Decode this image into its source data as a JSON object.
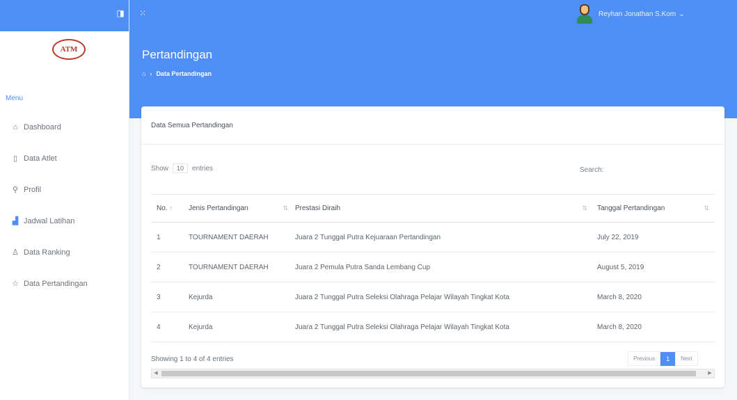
{
  "sidebar": {
    "logo_text": "ATM",
    "menu_title": "Menu",
    "items": [
      {
        "label": "Dashboard",
        "icon": "home-icon"
      },
      {
        "label": "Data Atlet",
        "icon": "document-icon"
      },
      {
        "label": "Profil",
        "icon": "user-icon"
      },
      {
        "label": "Jadwal Latihan",
        "icon": "bar-chart-icon"
      },
      {
        "label": "Data Ranking",
        "icon": "person-icon"
      },
      {
        "label": "Data Pertandingan",
        "icon": "star-icon"
      }
    ]
  },
  "header": {
    "user_name": "Reyhan Jonathan S.Kom"
  },
  "page": {
    "title": "Pertandingan",
    "breadcrumb_current": "Data Pertandingan"
  },
  "card": {
    "title": "Data Semua Pertandingan",
    "show_label": "Show",
    "show_value": "10",
    "entries_label": "entries",
    "search_label": "Search:",
    "columns": [
      "No.",
      "Jenis Pertandingan",
      "Prestasi Diraih",
      "Tanggal Pertandingan"
    ],
    "rows": [
      {
        "no": "1",
        "jenis": "TOURNAMENT DAERAH",
        "prestasi": "Juara 2 Tunggal Putra Kejuaraan Pertandingan",
        "tanggal": "July 22, 2019"
      },
      {
        "no": "2",
        "jenis": "TOURNAMENT DAERAH",
        "prestasi": "Juara 2 Pemula Putra Sanda Lembang Cup",
        "tanggal": "August 5, 2019"
      },
      {
        "no": "3",
        "jenis": "Kejurda",
        "prestasi": "Juara 2 Tunggal Putra Seleksi Olahraga Pelajar Wilayah Tingkat Kota",
        "tanggal": "March 8, 2020"
      },
      {
        "no": "4",
        "jenis": "Kejurda",
        "prestasi": "Juara 2 Tunggal Putra Seleksi Olahraga Pelajar Wilayah Tingkat Kota",
        "tanggal": "March 8, 2020"
      }
    ],
    "info": "Showing 1 to 4 of 4 entries",
    "prev_label": "Previous",
    "page_label": "1",
    "next_label": "Next"
  },
  "colors": {
    "primary": "#4f8ff5",
    "background": "#f4f6f9"
  }
}
